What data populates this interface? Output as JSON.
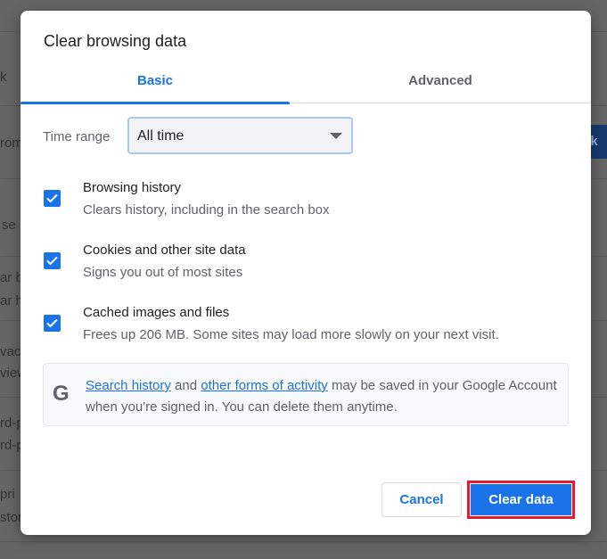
{
  "background": {
    "fragments": [
      "k",
      "rom",
      "se",
      "ar b",
      "ar h",
      "vacy",
      "view",
      "rd-p",
      "rd-p",
      "pri",
      "stor"
    ],
    "button_fragment": "ck"
  },
  "dialog": {
    "title": "Clear browsing data",
    "tabs": [
      {
        "label": "Basic",
        "active": true
      },
      {
        "label": "Advanced",
        "active": false
      }
    ],
    "time_range": {
      "label": "Time range",
      "value": "All time"
    },
    "options": [
      {
        "title": "Browsing history",
        "subtitle": "Clears history, including in the search box",
        "checked": true
      },
      {
        "title": "Cookies and other site data",
        "subtitle": "Signs you out of most sites",
        "checked": true
      },
      {
        "title": "Cached images and files",
        "subtitle": "Frees up 206 MB. Some sites may load more slowly on your next visit.",
        "checked": true
      }
    ],
    "info": {
      "icon": "google-g-icon",
      "logo": "G",
      "link1": "Search history",
      "mid": " and ",
      "link2": "other forms of activity",
      "rest": " may be saved in your Google Account when you're signed in. You can delete them anytime."
    },
    "buttons": {
      "cancel": "Cancel",
      "clear": "Clear data"
    },
    "colors": {
      "accent": "#1a73e8",
      "highlight": "#e8192c"
    }
  }
}
